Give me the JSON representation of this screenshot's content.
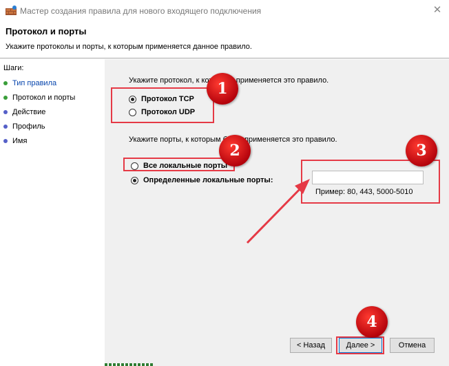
{
  "window": {
    "title": "Мастер создания правила для нового входящего подключения",
    "close_glyph": "✕"
  },
  "header": {
    "title": "Протокол и порты",
    "subtitle": "Укажите протоколы и порты, к которым применяется данное правило."
  },
  "sidebar": {
    "title": "Шаги:",
    "items": [
      {
        "label": "Тип правила",
        "dot_color": "#3a9e3a"
      },
      {
        "label": "Протокол и порты",
        "dot_color": "#3a9e3a"
      },
      {
        "label": "Действие",
        "dot_color": "#5560c8"
      },
      {
        "label": "Профиль",
        "dot_color": "#5560c8"
      },
      {
        "label": "Имя",
        "dot_color": "#5560c8"
      }
    ]
  },
  "protocol": {
    "prompt": "Укажите протокол, к которому применяется это правило.",
    "options": [
      {
        "label": "Протокол TCP",
        "checked": true
      },
      {
        "label": "Протокол UDP",
        "checked": false
      }
    ]
  },
  "ports": {
    "prompt": "Укажите порты, к которым будет применяется это правило.",
    "options": [
      {
        "label": "Все локальные порты",
        "checked": false
      },
      {
        "label": "Определенные локальные порты:",
        "checked": true
      }
    ],
    "input_value": "",
    "example": "Пример: 80, 443, 5000-5010"
  },
  "annotations": [
    "1",
    "2",
    "3",
    "4"
  ],
  "buttons": {
    "back": "< Назад",
    "next": "Далее >",
    "cancel": "Отмена"
  },
  "colors": {
    "highlight": "#e53945",
    "accent": "#0078d7"
  }
}
